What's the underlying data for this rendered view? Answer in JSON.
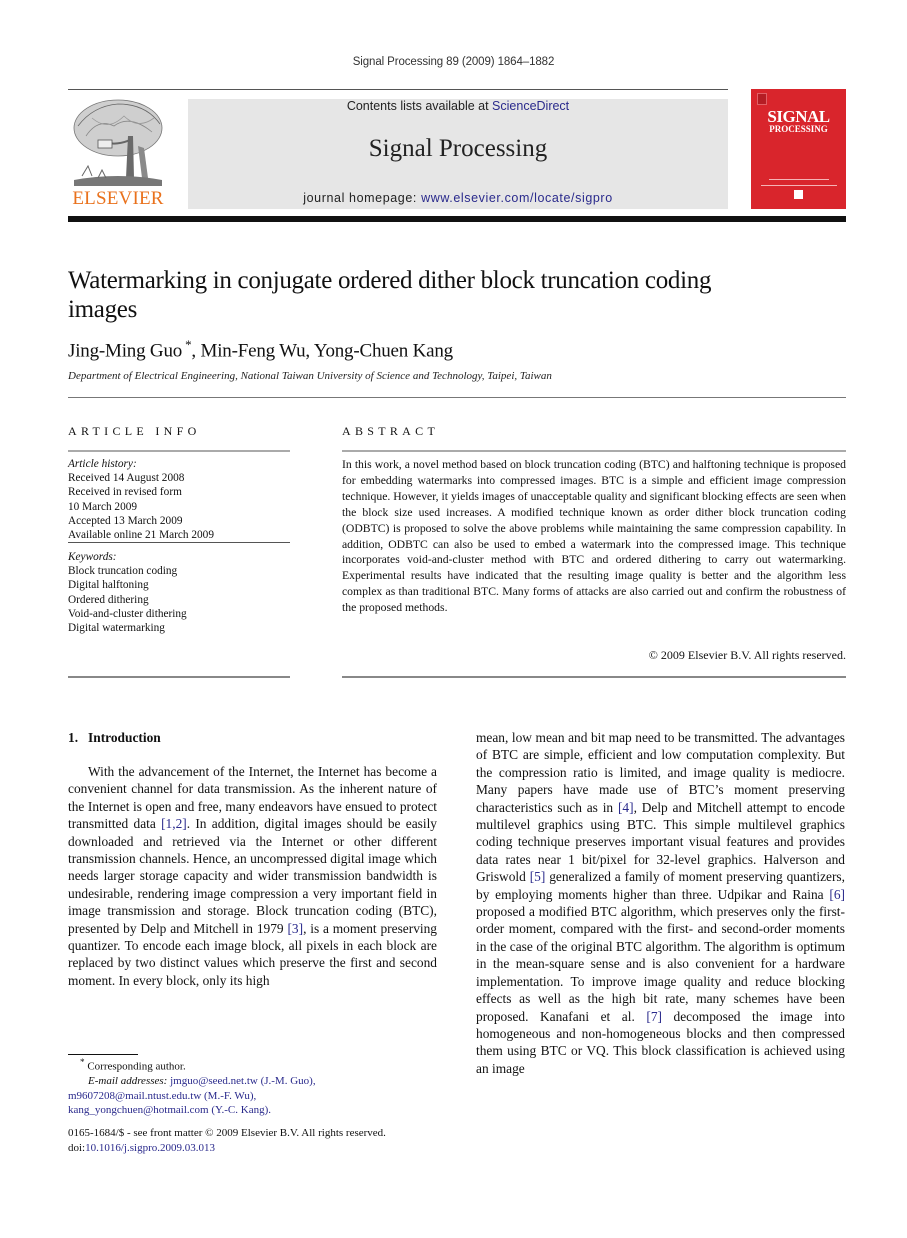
{
  "header": {
    "running_head": "Signal Processing 89 (2009) 1864–1882",
    "publisher_logo_text": "ELSEVIER",
    "contents_prefix": "Contents lists available at ",
    "contents_link": "ScienceDirect",
    "journal_title": "Signal Processing",
    "homepage_prefix": "journal homepage: ",
    "homepage_link": "www.elsevier.com/locate/sigpro",
    "cover": {
      "line1": "SIGNAL",
      "line2": "PROCESSING"
    }
  },
  "colors": {
    "elsevier_orange": "#e9711c",
    "cover_red": "#d9252c",
    "link_blue": "#2a2a8c",
    "banner_gray": "#e6e6e6"
  },
  "article": {
    "title": "Watermarking in conjugate ordered dither block truncation coding images",
    "authors": [
      {
        "name": "Jing-Ming Guo",
        "mark": "*"
      },
      {
        "name": "Min-Feng Wu",
        "mark": ""
      },
      {
        "name": "Yong-Chuen Kang",
        "mark": ""
      }
    ],
    "affiliation": "Department of Electrical Engineering, National Taiwan University of Science and Technology, Taipei, Taiwan"
  },
  "article_info": {
    "heading": "ARTICLE INFO",
    "history_label": "Article history:",
    "history": [
      "Received 14 August 2008",
      "Received in revised form",
      "10 March 2009",
      "Accepted 13 March 2009",
      "Available online 21 March 2009"
    ],
    "keywords_label": "Keywords:",
    "keywords": [
      "Block truncation coding",
      "Digital halftoning",
      "Ordered dithering",
      "Void-and-cluster dithering",
      "Digital watermarking"
    ]
  },
  "abstract": {
    "heading": "ABSTRACT",
    "text": "In this work, a novel method based on block truncation coding (BTC) and halftoning technique is proposed for embedding watermarks into compressed images. BTC is a simple and efficient image compression technique. However, it yields images of unacceptable quality and significant blocking effects are seen when the block size used increases. A modified technique known as order dither block truncation coding (ODBTC) is proposed to solve the above problems while maintaining the same compression capability. In addition, ODBTC can also be used to embed a watermark into the compressed image. This technique incorporates void-and-cluster method with BTC and ordered dithering to carry out watermarking. Experimental results have indicated that the resulting image quality is better and the algorithm less complex as than traditional BTC. Many forms of attacks are also carried out and confirm the robustness of the proposed methods.",
    "copyright": "© 2009 Elsevier B.V. All rights reserved."
  },
  "body": {
    "section_number": "1.",
    "section_title": "Introduction",
    "left_col": {
      "p1": "With the advancement of the Internet, the Internet has become a convenient channel for data transmission. As the inherent nature of the Internet is open and free, many endeavors have ensued to protect transmitted data ",
      "ref1": "[1,2]",
      "p2": ". In addition, digital images should be easily downloaded and retrieved via the Internet or other different transmission channels. Hence, an uncompressed digital image which needs larger storage capacity and wider transmission bandwidth is undesirable, rendering image compression a very important field in image transmission and storage. Block truncation coding (BTC), presented by Delp and Mitchell in 1979 ",
      "ref2": "[3]",
      "p3": ", is a moment preserving quantizer. To encode each image block, all pixels in each block are replaced by two distinct values which preserve the first and second moment. In every block, only its high"
    },
    "right_col": {
      "p1": "mean, low mean and bit map need to be transmitted. The advantages of BTC are simple, efficient and low computation complexity. But the compression ratio is limited, and image quality is mediocre. Many papers have made use of BTC’s moment preserving characteristics such as in ",
      "ref1": "[4]",
      "p2": ", Delp and Mitchell attempt to encode multilevel graphics using BTC. This simple multilevel graphics coding technique preserves important visual features and provides data rates near 1 bit/pixel for 32-level graphics. Halverson and Griswold ",
      "ref2": "[5]",
      "p3": " generalized a family of moment preserving quantizers, by employing moments higher than three. Udpikar and Raina ",
      "ref3": "[6]",
      "p4": " proposed a modified BTC algorithm, which preserves only the first-order moment, compared with the first- and second-order moments in the case of the original BTC algorithm. The algorithm is optimum in the mean-square sense and is also convenient for a hardware implementation. To improve image quality and reduce blocking effects as well as the high bit rate, many schemes have been proposed. Kanafani et al. ",
      "ref4": "[7]",
      "p5": " decomposed the image into homogeneous and non-homogeneous blocks and then compressed them using BTC or VQ. This block classification is achieved using an image"
    }
  },
  "footnotes": {
    "mark": "*",
    "corresponding": "Corresponding author.",
    "email_label": "E-mail addresses:",
    "emails": [
      {
        "address": "jmguo@seed.net.tw",
        "who": "(J.-M. Guo),"
      },
      {
        "address": "m9607208@mail.ntust.edu.tw",
        "who": "(M.-F. Wu),"
      },
      {
        "address": "kang_yongchuen@hotmail.com",
        "who": "(Y.-C. Kang)."
      }
    ],
    "front_matter": "0165-1684/$ - see front matter © 2009 Elsevier B.V. All rights reserved.",
    "doi_prefix": "doi:",
    "doi": "10.1016/j.sigpro.2009.03.013"
  }
}
